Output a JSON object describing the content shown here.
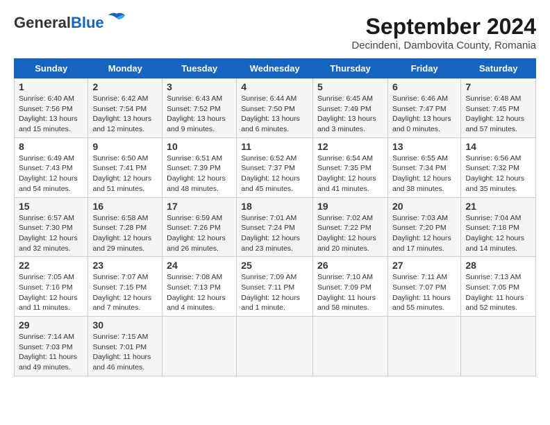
{
  "header": {
    "logo_general": "General",
    "logo_blue": "Blue",
    "title": "September 2024",
    "subtitle": "Decindeni, Dambovita County, Romania"
  },
  "columns": [
    "Sunday",
    "Monday",
    "Tuesday",
    "Wednesday",
    "Thursday",
    "Friday",
    "Saturday"
  ],
  "weeks": [
    [
      {
        "day": "1",
        "info": "Sunrise: 6:40 AM\nSunset: 7:56 PM\nDaylight: 13 hours and 15 minutes."
      },
      {
        "day": "2",
        "info": "Sunrise: 6:42 AM\nSunset: 7:54 PM\nDaylight: 13 hours and 12 minutes."
      },
      {
        "day": "3",
        "info": "Sunrise: 6:43 AM\nSunset: 7:52 PM\nDaylight: 13 hours and 9 minutes."
      },
      {
        "day": "4",
        "info": "Sunrise: 6:44 AM\nSunset: 7:50 PM\nDaylight: 13 hours and 6 minutes."
      },
      {
        "day": "5",
        "info": "Sunrise: 6:45 AM\nSunset: 7:49 PM\nDaylight: 13 hours and 3 minutes."
      },
      {
        "day": "6",
        "info": "Sunrise: 6:46 AM\nSunset: 7:47 PM\nDaylight: 13 hours and 0 minutes."
      },
      {
        "day": "7",
        "info": "Sunrise: 6:48 AM\nSunset: 7:45 PM\nDaylight: 12 hours and 57 minutes."
      }
    ],
    [
      {
        "day": "8",
        "info": "Sunrise: 6:49 AM\nSunset: 7:43 PM\nDaylight: 12 hours and 54 minutes."
      },
      {
        "day": "9",
        "info": "Sunrise: 6:50 AM\nSunset: 7:41 PM\nDaylight: 12 hours and 51 minutes."
      },
      {
        "day": "10",
        "info": "Sunrise: 6:51 AM\nSunset: 7:39 PM\nDaylight: 12 hours and 48 minutes."
      },
      {
        "day": "11",
        "info": "Sunrise: 6:52 AM\nSunset: 7:37 PM\nDaylight: 12 hours and 45 minutes."
      },
      {
        "day": "12",
        "info": "Sunrise: 6:54 AM\nSunset: 7:35 PM\nDaylight: 12 hours and 41 minutes."
      },
      {
        "day": "13",
        "info": "Sunrise: 6:55 AM\nSunset: 7:34 PM\nDaylight: 12 hours and 38 minutes."
      },
      {
        "day": "14",
        "info": "Sunrise: 6:56 AM\nSunset: 7:32 PM\nDaylight: 12 hours and 35 minutes."
      }
    ],
    [
      {
        "day": "15",
        "info": "Sunrise: 6:57 AM\nSunset: 7:30 PM\nDaylight: 12 hours and 32 minutes."
      },
      {
        "day": "16",
        "info": "Sunrise: 6:58 AM\nSunset: 7:28 PM\nDaylight: 12 hours and 29 minutes."
      },
      {
        "day": "17",
        "info": "Sunrise: 6:59 AM\nSunset: 7:26 PM\nDaylight: 12 hours and 26 minutes."
      },
      {
        "day": "18",
        "info": "Sunrise: 7:01 AM\nSunset: 7:24 PM\nDaylight: 12 hours and 23 minutes."
      },
      {
        "day": "19",
        "info": "Sunrise: 7:02 AM\nSunset: 7:22 PM\nDaylight: 12 hours and 20 minutes."
      },
      {
        "day": "20",
        "info": "Sunrise: 7:03 AM\nSunset: 7:20 PM\nDaylight: 12 hours and 17 minutes."
      },
      {
        "day": "21",
        "info": "Sunrise: 7:04 AM\nSunset: 7:18 PM\nDaylight: 12 hours and 14 minutes."
      }
    ],
    [
      {
        "day": "22",
        "info": "Sunrise: 7:05 AM\nSunset: 7:16 PM\nDaylight: 12 hours and 11 minutes."
      },
      {
        "day": "23",
        "info": "Sunrise: 7:07 AM\nSunset: 7:15 PM\nDaylight: 12 hours and 7 minutes."
      },
      {
        "day": "24",
        "info": "Sunrise: 7:08 AM\nSunset: 7:13 PM\nDaylight: 12 hours and 4 minutes."
      },
      {
        "day": "25",
        "info": "Sunrise: 7:09 AM\nSunset: 7:11 PM\nDaylight: 12 hours and 1 minute."
      },
      {
        "day": "26",
        "info": "Sunrise: 7:10 AM\nSunset: 7:09 PM\nDaylight: 11 hours and 58 minutes."
      },
      {
        "day": "27",
        "info": "Sunrise: 7:11 AM\nSunset: 7:07 PM\nDaylight: 11 hours and 55 minutes."
      },
      {
        "day": "28",
        "info": "Sunrise: 7:13 AM\nSunset: 7:05 PM\nDaylight: 11 hours and 52 minutes."
      }
    ],
    [
      {
        "day": "29",
        "info": "Sunrise: 7:14 AM\nSunset: 7:03 PM\nDaylight: 11 hours and 49 minutes."
      },
      {
        "day": "30",
        "info": "Sunrise: 7:15 AM\nSunset: 7:01 PM\nDaylight: 11 hours and 46 minutes."
      },
      {
        "day": "",
        "info": ""
      },
      {
        "day": "",
        "info": ""
      },
      {
        "day": "",
        "info": ""
      },
      {
        "day": "",
        "info": ""
      },
      {
        "day": "",
        "info": ""
      }
    ]
  ]
}
